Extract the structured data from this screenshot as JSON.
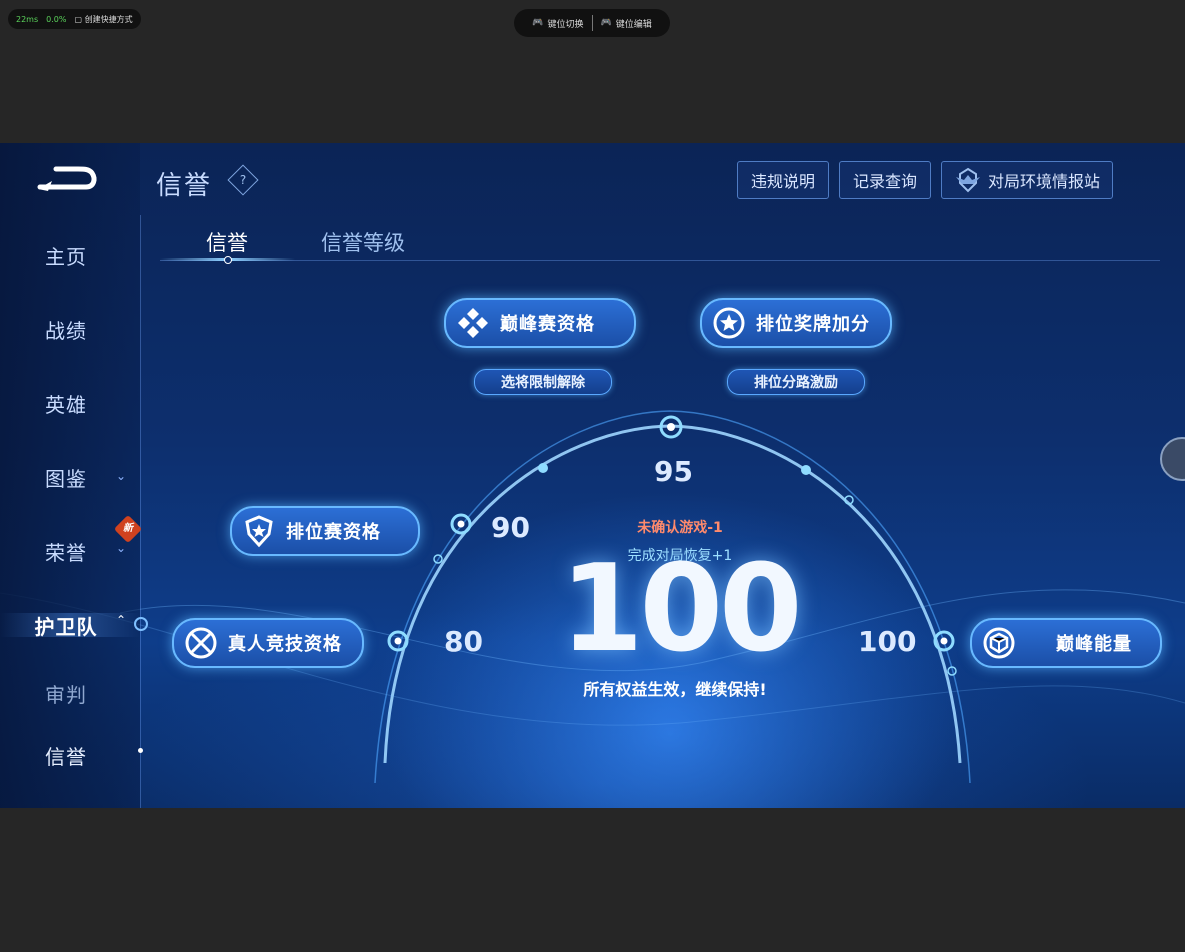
{
  "overlay": {
    "latency": "22ms",
    "loss": "0.0%",
    "shortcut_label": "创建快捷方式",
    "key_switch": "键位切换",
    "key_edit": "键位编辑"
  },
  "sidebar": {
    "items": [
      {
        "label": "主页"
      },
      {
        "label": "战绩"
      },
      {
        "label": "英雄"
      },
      {
        "label": "图鉴"
      },
      {
        "label": "荣誉"
      },
      {
        "label": "护卫队"
      },
      {
        "label": "审判"
      },
      {
        "label": "信誉"
      }
    ],
    "new_badge": "新"
  },
  "header": {
    "title": "信誉",
    "help": "?",
    "buttons": {
      "violation": "违规说明",
      "records": "记录查询",
      "env": "对局环境情报站"
    }
  },
  "tabs": [
    {
      "label": "信誉"
    },
    {
      "label": "信誉等级"
    }
  ],
  "perks": {
    "peak_qualification": "巅峰赛资格",
    "rank_medal_bonus": "排位奖牌加分",
    "pick_limit_lift": "选将限制解除",
    "rank_lane_incentive": "排位分路激励",
    "ranked_qualification": "排位赛资格",
    "real_competitive": "真人竞技资格",
    "peak_energy": "巅峰能量"
  },
  "gauge": {
    "ticks": {
      "t80": "80",
      "t90": "90",
      "t95": "95",
      "t100": "100"
    },
    "score": "100",
    "warning": "未确认游戏-1",
    "recover": "完成对局恢复+1",
    "status": "所有权益生效，继续保持!"
  },
  "colors": {
    "accent": "#68b9ff",
    "warning": "#ff8a6c",
    "background": "#0d2f6e"
  }
}
